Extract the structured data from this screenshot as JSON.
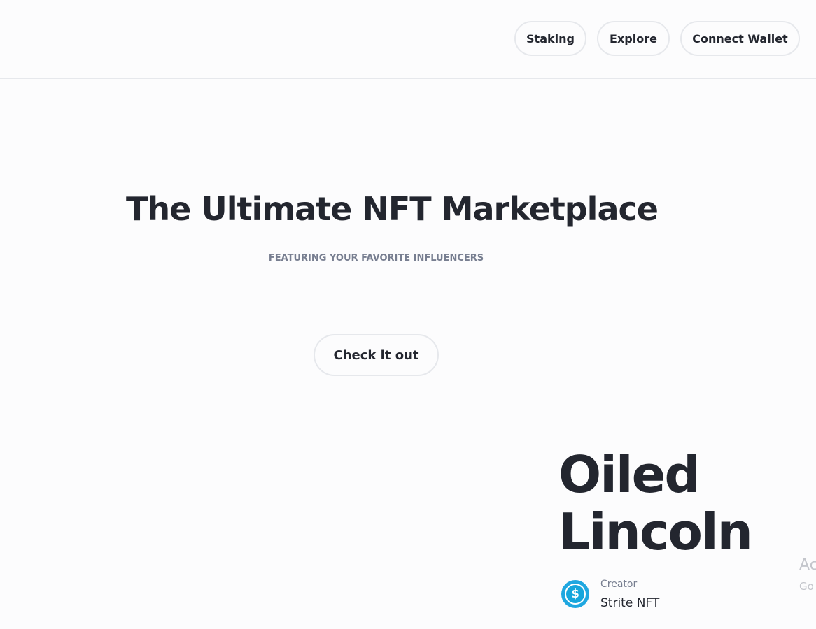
{
  "header": {
    "nav": {
      "staking_label": "Staking",
      "explore_label": "Explore",
      "connect_wallet_label": "Connect Wallet"
    }
  },
  "hero": {
    "title": "The Ultimate NFT Marketplace",
    "subtitle": "FEATURING YOUR FAVORITE INFLUENCERS",
    "cta_label": "Check it out"
  },
  "featured_nft": {
    "title": "Oiled Lincoln",
    "creator_label": "Creator",
    "creator_name": "Strite NFT",
    "creator_avatar_icon": "dollar-coin-icon"
  },
  "os_watermark": {
    "line1": "Ac",
    "line2": "Go"
  },
  "colors": {
    "background": "#fcfcfd",
    "text_primary": "#23262f",
    "text_secondary": "#777e90",
    "border": "#e6e8ec",
    "avatar_accent": "#16a6dc"
  }
}
